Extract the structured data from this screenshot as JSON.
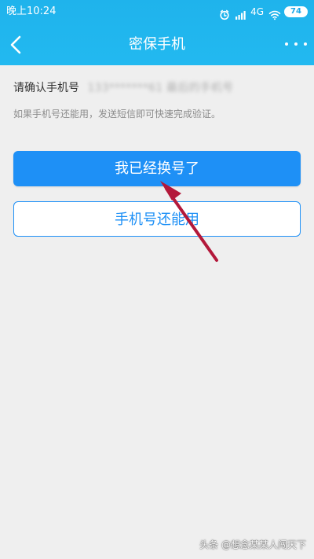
{
  "status_bar": {
    "time": "晚上10:24",
    "network": "4G",
    "battery": "74"
  },
  "titlebar": {
    "title": "密保手机"
  },
  "content": {
    "phone_prompt": "请确认手机号",
    "phone_number": "133*******61 最后的手机号",
    "hint": "如果手机号还能用，发送短信即可快速完成验证。",
    "primary_button": "我已经换号了",
    "secondary_button": "手机号还能用"
  },
  "watermark": {
    "text": "头条 @想念某某人闯天下"
  },
  "colors": {
    "header": "#22b9f0",
    "primary": "#1e90f6",
    "annotation_arrow": "#b3183a"
  },
  "icons": {
    "back": "chevron-left-icon",
    "more": "more-dots-icon",
    "alarm": "alarm-icon",
    "signal": "signal-icon",
    "wifi": "wifi-icon"
  }
}
